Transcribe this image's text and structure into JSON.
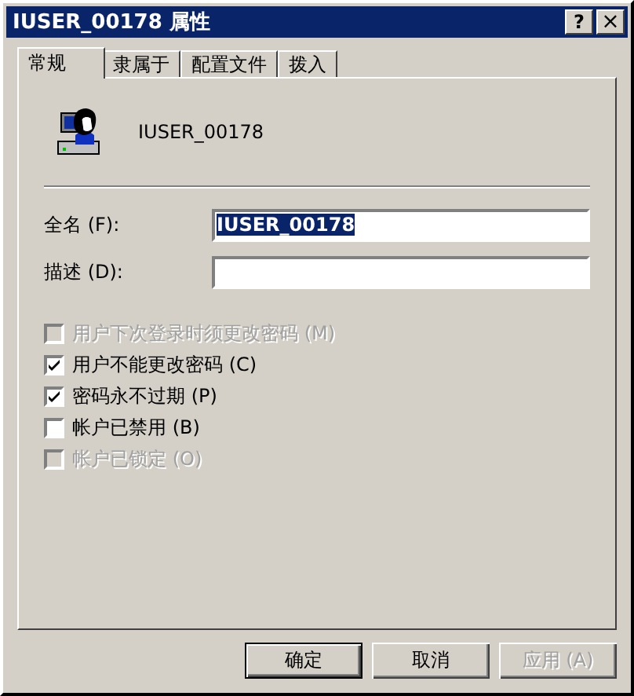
{
  "window": {
    "title": "IUSER_00178 属性",
    "buttons": [
      {
        "kind": "help",
        "label": "?"
      },
      {
        "kind": "close",
        "label": "×"
      }
    ]
  },
  "tabs": [
    {
      "label": "常规",
      "selected": true
    },
    {
      "label": "隶属于",
      "selected": false
    },
    {
      "label": "配置文件",
      "selected": false
    },
    {
      "label": "拨入",
      "selected": false
    }
  ],
  "user_name": "IUSER_00178",
  "fields": [
    {
      "label": "全名 (F):",
      "value": "IUSER_00178",
      "text_selected": true
    },
    {
      "label": "描述 (D):"
    }
  ],
  "options": [
    {
      "label": "用户下次登录时须更改密码 (M)",
      "checked": false,
      "disabled": true
    },
    {
      "label": "用户不能更改密码 (C)",
      "checked": true,
      "disabled": false
    },
    {
      "label": "密码永不过期 (P)",
      "checked": true,
      "disabled": false
    },
    {
      "label": "帐户已禁用 (B)",
      "checked": false,
      "disabled": false
    },
    {
      "label": "帐户已锁定 (O)",
      "checked": false,
      "disabled": true
    }
  ],
  "buttons": [
    {
      "label": "确定",
      "default": true,
      "disabled": false
    },
    {
      "label": "取消",
      "default": false,
      "disabled": false
    },
    {
      "label": "应用 (A)",
      "default": false,
      "disabled": true
    }
  ]
}
